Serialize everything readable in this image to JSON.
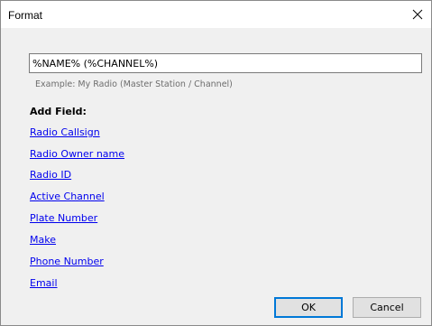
{
  "window": {
    "title": "Format"
  },
  "format": {
    "value": "%NAME% (%CHANNEL%)",
    "example": "Example: My Radio (Master Station / Channel)"
  },
  "add_field": {
    "heading": "Add Field:",
    "links": [
      "Radio Callsign",
      "Radio Owner name",
      "Radio ID",
      "Active Channel",
      "Plate Number",
      "Make",
      "Phone Number",
      "Email"
    ]
  },
  "buttons": {
    "ok": "OK",
    "cancel": "Cancel"
  },
  "icons": {
    "close": "close-icon"
  },
  "colors": {
    "link": "#0000ee",
    "default_button_border": "#0078d7",
    "dialog_bg": "#f0f0f0"
  }
}
